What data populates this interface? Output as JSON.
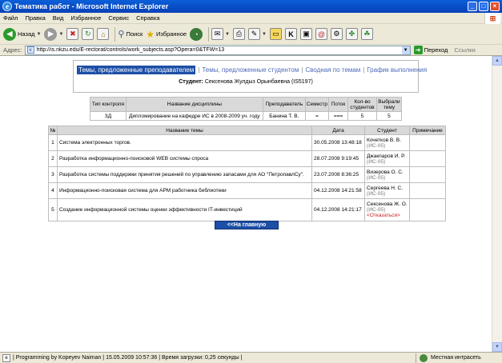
{
  "window": {
    "title": "Тематика работ - Microsoft Internet Explorer",
    "buttons": [
      "_",
      "□",
      "×"
    ]
  },
  "menu": [
    "Файл",
    "Правка",
    "Вид",
    "Избранное",
    "Сервис",
    "Справка"
  ],
  "toolbar": {
    "back_label": "Назад",
    "search_label": "Поиск",
    "favorites_label": "Избранное"
  },
  "address": {
    "label": "Адрес:",
    "url": "http://is.nkzu.edu/E-rectorat/controls/work_subjects.asp?Opera=0&TFW=13",
    "go_label": "Переход",
    "links_label": "Ссылки"
  },
  "nav": {
    "active": "Темы, предложенные преподавателем",
    "links": [
      "Темы, предложенные студентом",
      "Сводная по темам",
      "График выполнения"
    ]
  },
  "student": {
    "key": "Студент:",
    "value": "Сексенова Жулдыз Орынбаевна (IS5197)"
  },
  "discipline_table": {
    "headers": [
      "Тип контроля",
      "Название дисциплины",
      "Преподаватель",
      "Семестр",
      "Поток",
      "Кол-во студентов",
      "Выбрали тему"
    ],
    "row": [
      "ЗД",
      "Дипломирование на кафедре ИС в 2008-2009 уч. году",
      "Банина Т. В.",
      "=",
      "===",
      "5",
      "5"
    ]
  },
  "topics_table": {
    "headers": [
      "№",
      "Название темы",
      "Дата",
      "Студент",
      "Примечание"
    ],
    "rows": [
      {
        "n": "1",
        "title": "Система электронных торгов.",
        "date": "30.05.2008 13:48:18",
        "student": "Кочетков В. В.",
        "group": "(ИС-05)",
        "extra": "",
        "note": ""
      },
      {
        "n": "2",
        "title": "Разработка информационно-поисковой WEB системы спроса",
        "date": "28.07.2008 9:19:45",
        "student": "Джакпаров И. Р.",
        "group": "(ИС-05)",
        "extra": "",
        "note": ""
      },
      {
        "n": "3",
        "title": "Разработка системы поддержки принятия решений по управлению запасами для АО \"ПетропавлСу\".",
        "date": "23.07.2008 8:36:25",
        "student": "Визерова О. С.",
        "group": "(ИС-05)",
        "extra": "",
        "note": ""
      },
      {
        "n": "4",
        "title": "Информационно-поисковая система для АРМ работника библиотеки",
        "date": "04.12.2008 14:21:58",
        "student": "Сергеева Н. С.",
        "group": "(ИС-05)",
        "extra": "",
        "note": ""
      },
      {
        "n": "5",
        "title": "Создание информационной системы оценки эффективности IT-инвестиций",
        "date": "04.12.2008 14:21:17",
        "student": "Сексенова Ж. О.",
        "group": "(ИС-05)",
        "extra": "<Отказаться>",
        "note": ""
      }
    ]
  },
  "home_button": "<<На главную",
  "status": {
    "text": "| Programming by Kopeyev Naiman | 15.05.2009 10:57:36 | Время загрузки: 0,25 секунды |",
    "zone": "Местная интрасеть"
  }
}
